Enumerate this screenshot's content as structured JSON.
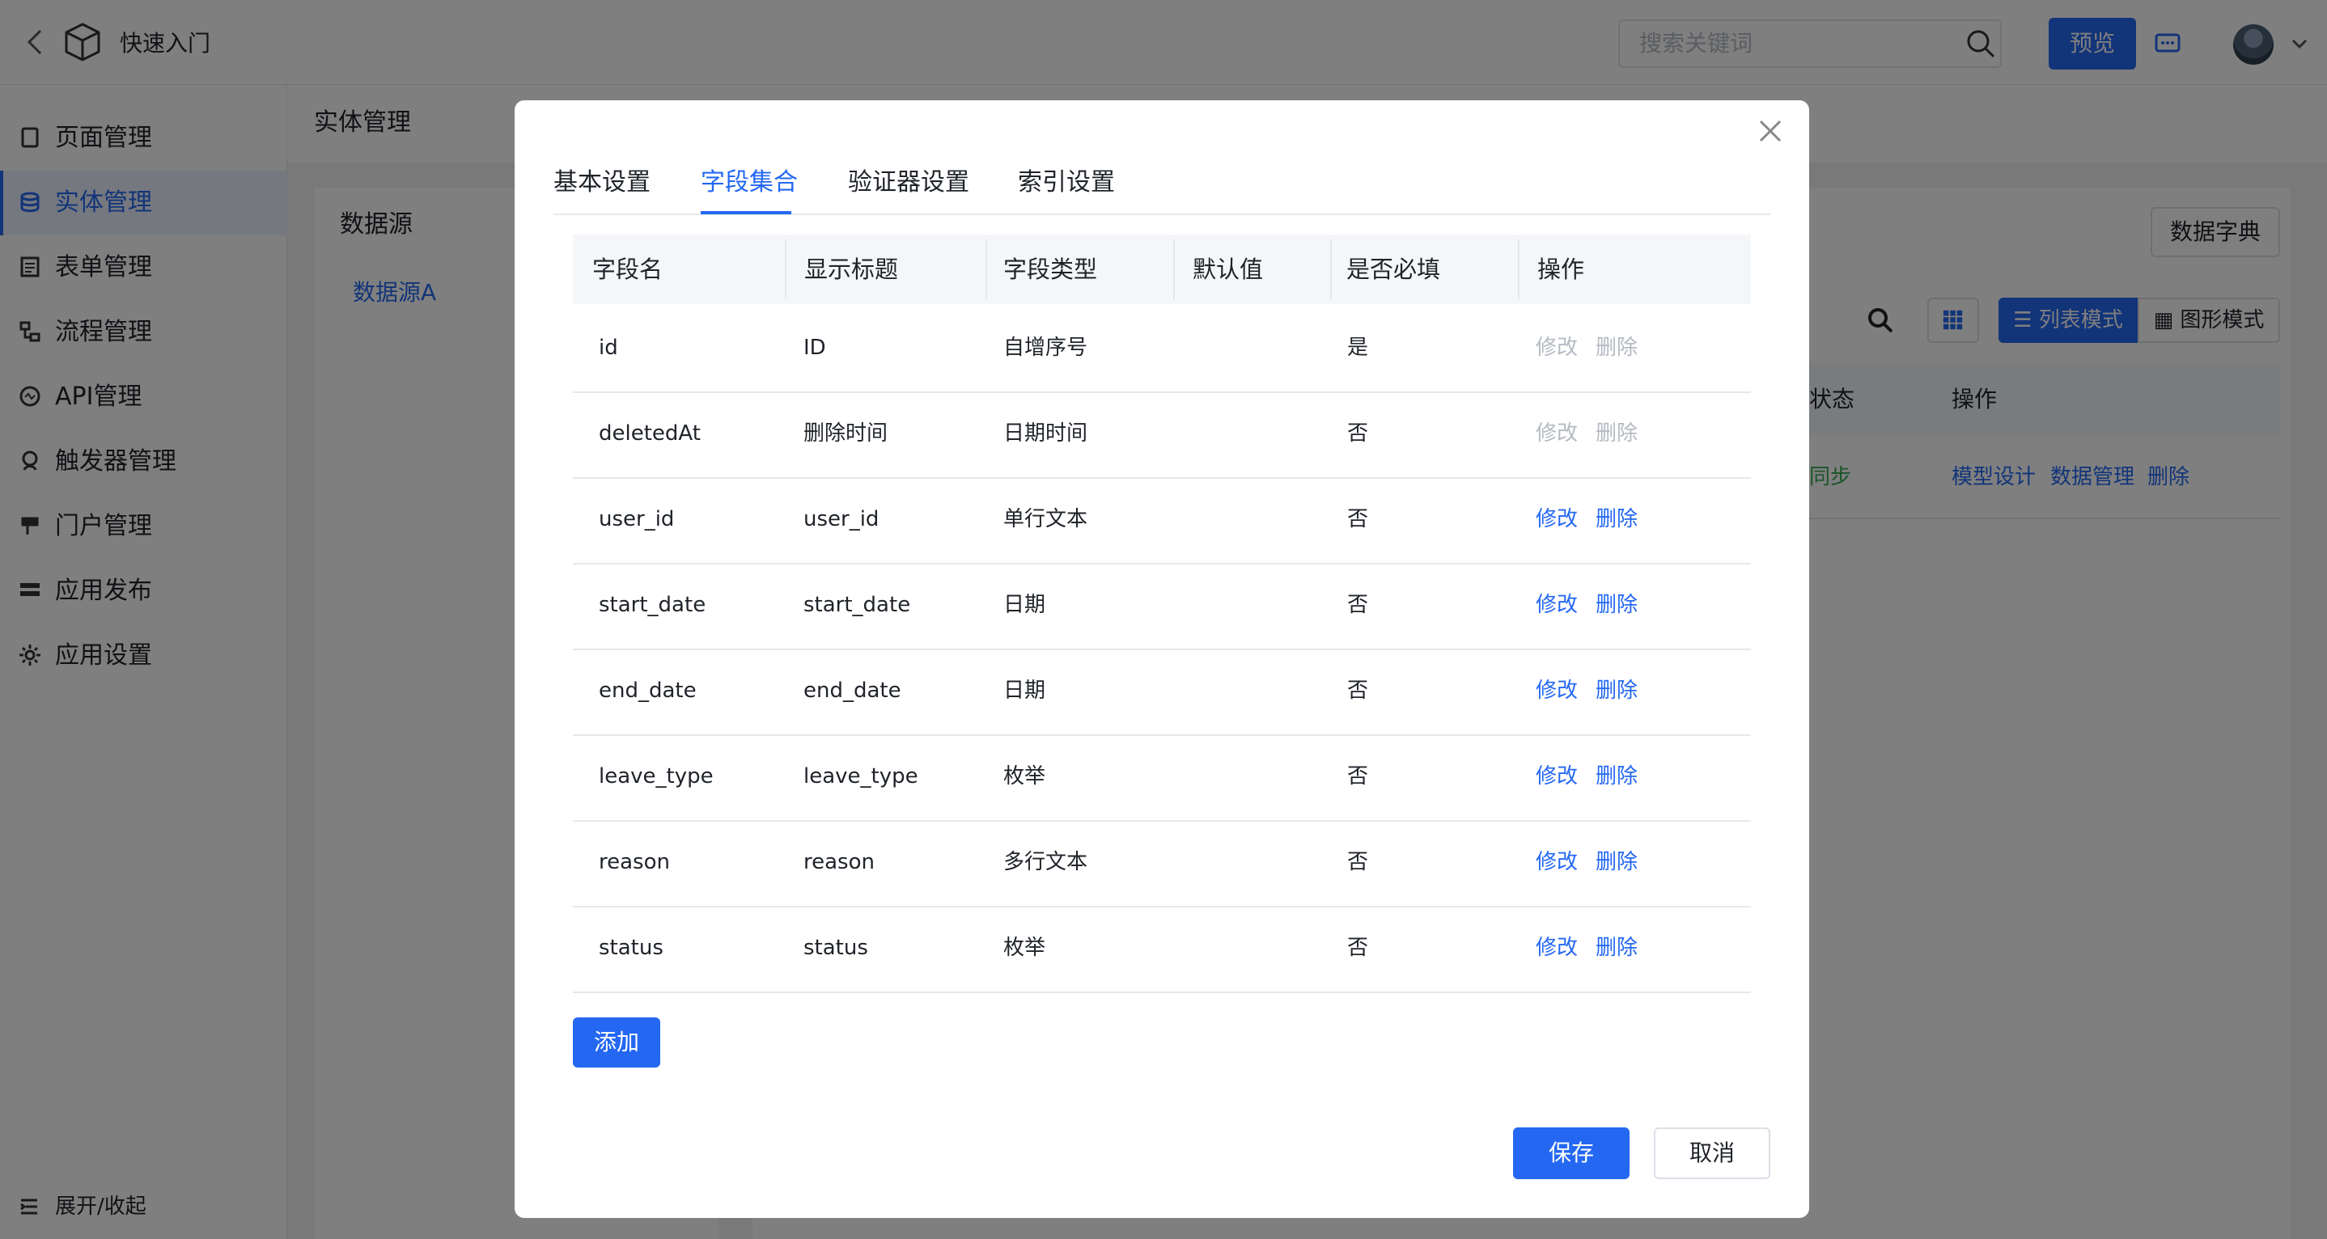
{
  "header": {
    "title": "快速入门",
    "search_placeholder": "搜索关键词",
    "preview_label": "预览"
  },
  "sidebar": {
    "items": [
      {
        "label": "页面管理",
        "icon": "page-icon"
      },
      {
        "label": "实体管理",
        "icon": "database-icon",
        "active": true
      },
      {
        "label": "表单管理",
        "icon": "form-icon"
      },
      {
        "label": "流程管理",
        "icon": "flow-icon"
      },
      {
        "label": "API管理",
        "icon": "api-icon"
      },
      {
        "label": "触发器管理",
        "icon": "trigger-icon"
      },
      {
        "label": "门户管理",
        "icon": "portal-icon"
      },
      {
        "label": "应用发布",
        "icon": "publish-icon"
      },
      {
        "label": "应用设置",
        "icon": "gear-icon"
      }
    ],
    "collapse_label": "展开/收起"
  },
  "main": {
    "breadcrumb": "实体管理",
    "datasource_title": "数据源",
    "datasource_item": "数据源A",
    "dict_button": "数据字典",
    "list_mode": "列表模式",
    "graph_mode": "图形模式",
    "table_headers": {
      "status": "状态",
      "actions": "操作"
    },
    "row": {
      "status": "同步",
      "links": [
        "模型设计",
        "数据管理",
        "删除"
      ]
    }
  },
  "modal": {
    "tabs": [
      "基本设置",
      "字段集合",
      "验证器设置",
      "索引设置"
    ],
    "active_tab": "字段集合",
    "columns": [
      "字段名",
      "显示标题",
      "字段类型",
      "默认值",
      "是否必填",
      "操作"
    ],
    "rows": [
      {
        "name": "id",
        "title": "ID",
        "type": "自增序号",
        "default": "",
        "required": "是",
        "editable": false
      },
      {
        "name": "deletedAt",
        "title": "删除时间",
        "type": "日期时间",
        "default": "",
        "required": "否",
        "editable": false
      },
      {
        "name": "user_id",
        "title": "user_id",
        "type": "单行文本",
        "default": "",
        "required": "否",
        "editable": true
      },
      {
        "name": "start_date",
        "title": "start_date",
        "type": "日期",
        "default": "",
        "required": "否",
        "editable": true
      },
      {
        "name": "end_date",
        "title": "end_date",
        "type": "日期",
        "default": "",
        "required": "否",
        "editable": true
      },
      {
        "name": "leave_type",
        "title": "leave_type",
        "type": "枚举",
        "default": "",
        "required": "否",
        "editable": true
      },
      {
        "name": "reason",
        "title": "reason",
        "type": "多行文本",
        "default": "",
        "required": "否",
        "editable": true
      },
      {
        "name": "status",
        "title": "status",
        "type": "枚举",
        "default": "",
        "required": "否",
        "editable": true
      }
    ],
    "edit_label": "修改",
    "delete_label": "删除",
    "add_label": "添加",
    "save_label": "保存",
    "cancel_label": "取消"
  },
  "colors": {
    "accent": "#2468f2",
    "success": "#34a853",
    "disabled": "#b5bac2"
  }
}
